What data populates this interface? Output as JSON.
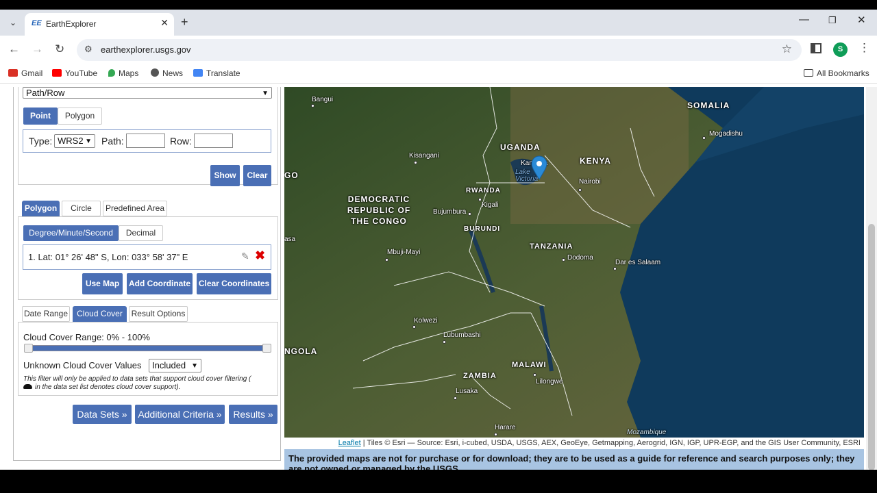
{
  "browser": {
    "tab_favicon": "EE",
    "tab_title": "EarthExplorer",
    "url": "earthexplorer.usgs.gov",
    "avatar_letter": "S",
    "bookmarks": [
      "Gmail",
      "YouTube",
      "Maps",
      "News",
      "Translate"
    ],
    "all_bookmarks": "All Bookmarks"
  },
  "search": {
    "coordinate_mode": "Path/Row",
    "point_tab": "Point",
    "polygon_tab": "Polygon",
    "type_label": "Type:",
    "type_value": "WRS2",
    "path_label": "Path:",
    "row_label": "Row:",
    "show_btn": "Show",
    "clear_btn": "Clear"
  },
  "area": {
    "tabs": [
      "Polygon",
      "Circle",
      "Predefined Area"
    ],
    "format_tabs": [
      "Degree/Minute/Second",
      "Decimal"
    ],
    "coordinate": "1.  Lat: 01° 26' 48\" S, Lon: 033° 58' 37\" E",
    "use_map": "Use Map",
    "add_coord": "Add Coordinate",
    "clear_coords": "Clear Coordinates"
  },
  "filters": {
    "tabs": [
      "Date Range",
      "Cloud Cover",
      "Result Options"
    ],
    "cloud_range_label": "Cloud Cover Range: 0% - 100%",
    "cloud_min": 0,
    "cloud_max": 100,
    "unknown_label": "Unknown Cloud Cover Values",
    "unknown_value": "Included",
    "note": "This filter will only be applied to data sets that support cloud cover filtering (",
    "note2": "in the data set list denotes cloud cover support)."
  },
  "nav_buttons": [
    "Data Sets »",
    "Additional Criteria »",
    "Results »"
  ],
  "map": {
    "countries": [
      "SOMALIA",
      "UGANDA",
      "KENYA",
      "RWANDA",
      "BURUNDI",
      "DEMOCRATIC REPUBLIC OF THE CONGO",
      "TANZANIA",
      "MALAWI",
      "ZAMBIA",
      "NGOLA",
      "GO"
    ],
    "places": [
      "Bangui",
      "Mogadishu",
      "Kisangani",
      "Kampala",
      "Lake Victoria",
      "Nairobi",
      "Kigali",
      "Bujumbura",
      "Dodoma",
      "Dar es Salaam",
      "Mbuji-Mayi",
      "Kolwezi",
      "Lubumbashi",
      "Lilongwe",
      "Lusaka",
      "Harare",
      "Mozambique",
      "asa"
    ],
    "attribution_link": "Leaflet",
    "attribution": " | Tiles © Esri — Source: Esri, i-cubed, USDA, USGS, AEX, GeoEye, Getmapping, Aerogrid, IGN, IGP, UPR-EGP, and the GIS User Community, ESRI",
    "disclaimer": "The provided maps are not for purchase or for download; they are to be used as a guide for reference and search purposes only; they are not owned or managed by the USGS."
  }
}
